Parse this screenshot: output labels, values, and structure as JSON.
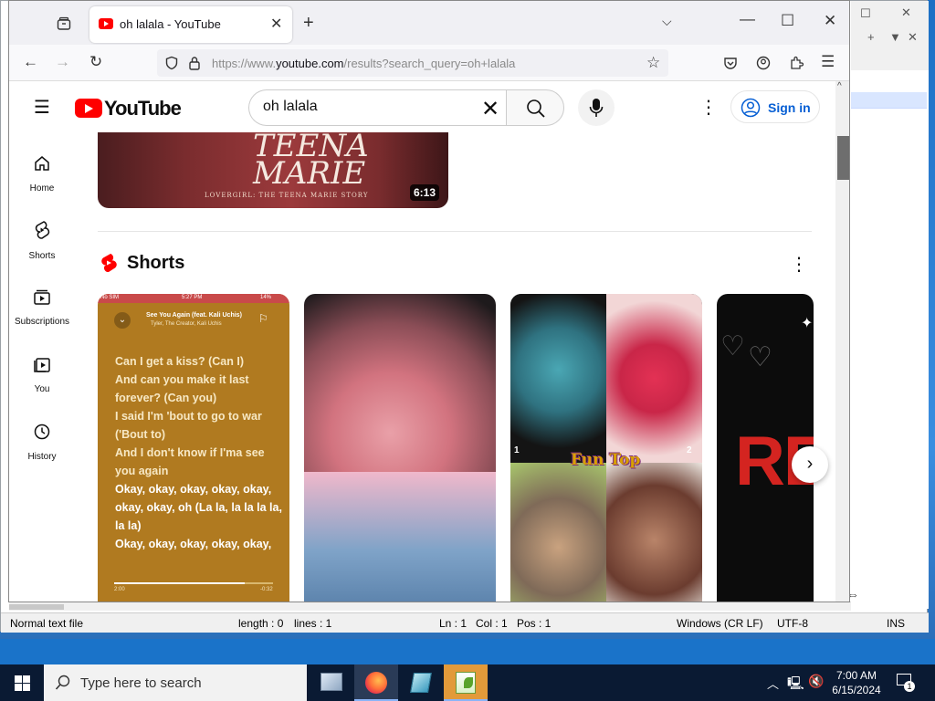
{
  "browser": {
    "tab_title": "oh lalala - YouTube",
    "url_prefix": "https://www.",
    "url_domain": "youtube.com",
    "url_path": "/results?search_query=oh+lalala"
  },
  "youtube": {
    "logo_text": "YouTube",
    "search_value": "oh lalala",
    "sign_in": "Sign in",
    "sidebar": [
      {
        "label": "Home"
      },
      {
        "label": "Shorts"
      },
      {
        "label": "Subscriptions"
      },
      {
        "label": "You"
      },
      {
        "label": "History"
      }
    ],
    "video": {
      "thumb_title": "TEENA MARIE",
      "thumb_subtitle": "LOVERGIRL: THE TEENA MARIE STORY",
      "duration": "6:13"
    },
    "shorts_heading": "Shorts",
    "shorts": [
      {
        "status_left": "No SIM",
        "status_time": "5:27 PM",
        "status_right": "14%",
        "song": "See You Again (feat. Kali Uchis)",
        "artist": "Tyler, The Creator, Kali Uchis",
        "lyrics": [
          "Can I get a kiss? (Can I)",
          "And can you make it last",
          "forever? (Can you)",
          "I said I'm 'bout to go to war",
          "('Bout to)",
          "And I don't know if I'ma see",
          "you again",
          "Okay, okay, okay, okay, okay,",
          "okay, okay, oh (La la, la la la la,",
          "la la)",
          "Okay, okay, okay, okay, okay,"
        ],
        "progress": 0.82,
        "time_start": "2:00",
        "time_end": "-0:32"
      },
      {},
      {
        "overlay_text": "Fun Top",
        "label_1": "1",
        "label_2": "2"
      },
      {
        "overlay_text": "RE"
      }
    ]
  },
  "notepad": {
    "status": {
      "type": "Normal text file",
      "length": "length : 0",
      "lines": "lines : 1",
      "ln": "Ln : 1",
      "col": "Col : 1",
      "pos": "Pos : 1",
      "eol": "Windows (CR LF)",
      "enc": "UTF-8",
      "mode": "INS"
    }
  },
  "taskbar": {
    "search_placeholder": "Type here to search",
    "time": "7:00 AM",
    "date": "6/15/2024",
    "notif_count": "1"
  },
  "colors": {
    "yt_red": "#ff0000",
    "link_blue": "#065fd4",
    "taskbar": "#0a1a33"
  }
}
